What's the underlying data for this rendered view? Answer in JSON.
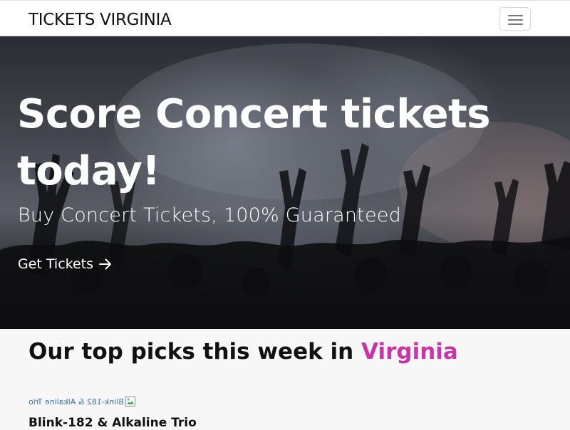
{
  "navbar": {
    "brand": "TICKETS VIRGINIA",
    "menu_icon": "hamburger-menu-icon"
  },
  "hero": {
    "title": "Score Concert tickets today!",
    "subtitle": "Buy Concert Tickets, 100% Guaranteed",
    "cta_label": "Get Tickets",
    "cta_icon": "arrow-right-icon"
  },
  "picks": {
    "title_prefix": "Our top picks this week in",
    "title_location": "Virginia",
    "accent_color": "#c735a6",
    "items": [
      {
        "image_alt": "Blink-182 & Alkaline Trio",
        "name": "Blink-182 & Alkaline Trio"
      }
    ]
  }
}
